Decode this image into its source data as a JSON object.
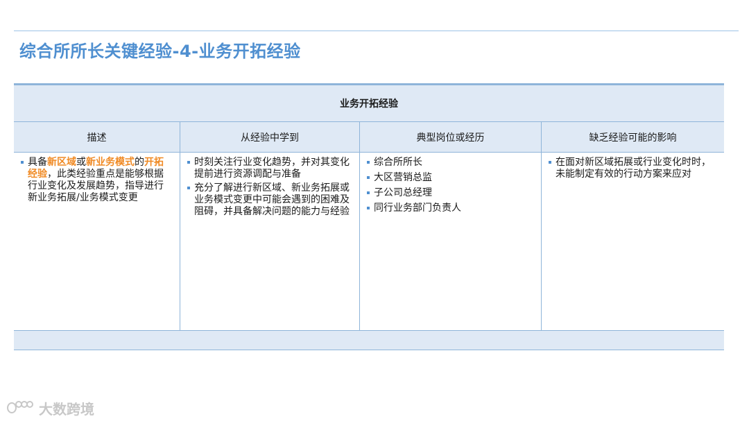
{
  "page": {
    "title": "综合所所长关键经验-4-业务开拓经验"
  },
  "table": {
    "title": "业务开拓经验",
    "headers": [
      "描述",
      "从经验中学到",
      "典型岗位或经历",
      "缺乏经验可能的影响"
    ],
    "description": {
      "p1": "具备",
      "h1": "新区域",
      "p2": "或",
      "h2": "新业务模式",
      "p3": "的",
      "h3": "开拓经验",
      "p4": "，此类经验重点是能够根据行业变化及发展趋势，指导进行新业务拓展/业务模式变更"
    },
    "learned": [
      "时刻关注行业变化趋势，并对其变化提前进行资源调配与准备",
      "充分了解进行新区域、新业务拓展或业务模式变更中可能会遇到的困难及阻碍，并具备解决问题的能力与经验"
    ],
    "positions": [
      "综合所所长",
      "大区营销总监",
      "子公司总经理",
      "同行业务部门负责人"
    ],
    "impact": [
      "在面对新区域拓展或行业变化时时，未能制定有效的行动方案来应对"
    ]
  },
  "colors": {
    "accent": "#4f8fd0",
    "highlight": "#f08a24",
    "header_bg": "#dfe9f5",
    "border": "#8eb4d9"
  },
  "watermark": {
    "text": "大数跨境",
    "icon": "logo-icon"
  }
}
